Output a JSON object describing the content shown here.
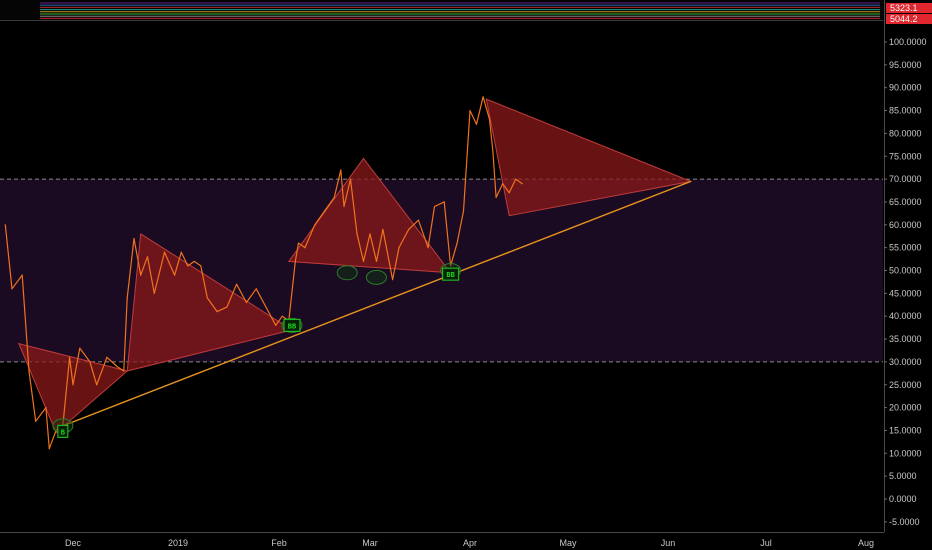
{
  "chart_data": {
    "type": "line",
    "title": "",
    "xlabel": "",
    "ylabel": "",
    "ylim": [
      -5,
      105
    ],
    "y_ticks": [
      "100.0000",
      "95.0000",
      "90.0000",
      "85.0000",
      "80.0000",
      "75.0000",
      "70.0000",
      "65.0000",
      "60.0000",
      "55.0000",
      "50.0000",
      "45.0000",
      "40.0000",
      "35.0000",
      "30.0000",
      "25.0000",
      "20.0000",
      "15.0000",
      "10.0000",
      "5.0000",
      "0.0000",
      "-5.0000"
    ],
    "y_tick_values": [
      100,
      95,
      90,
      85,
      80,
      75,
      70,
      65,
      60,
      55,
      50,
      45,
      40,
      35,
      30,
      25,
      20,
      15,
      10,
      5,
      0,
      -5
    ],
    "x_ticks": [
      "Dec",
      "2019",
      "Feb",
      "Mar",
      "Apr",
      "May",
      "Jun",
      "Jul",
      "Aug"
    ],
    "x_tick_dates": [
      "2018-12-01",
      "2019-01-01",
      "2019-02-01",
      "2019-03-01",
      "2019-04-01",
      "2019-05-01",
      "2019-06-01",
      "2019-07-01",
      "2019-08-01"
    ],
    "x_range": [
      "2018-11-11",
      "2019-08-10"
    ],
    "horizontal_levels": [
      70,
      30
    ],
    "zone": {
      "from": 30,
      "to": 70,
      "color": "#1a0a22"
    },
    "price_badges": [
      "5323.1",
      "5044.2"
    ],
    "series": [
      {
        "color": "#f0731c",
        "points": [
          [
            "2018-11-11",
            60
          ],
          [
            "2018-11-13",
            46
          ],
          [
            "2018-11-16",
            49
          ],
          [
            "2018-11-18",
            28
          ],
          [
            "2018-11-20",
            17
          ],
          [
            "2018-11-23",
            20
          ],
          [
            "2018-11-24",
            11
          ],
          [
            "2018-11-26",
            15
          ],
          [
            "2018-11-28",
            16
          ],
          [
            "2018-11-30",
            31
          ],
          [
            "2018-12-01",
            25
          ],
          [
            "2018-12-03",
            33
          ],
          [
            "2018-12-06",
            30
          ],
          [
            "2018-12-08",
            25
          ],
          [
            "2018-12-11",
            31
          ],
          [
            "2018-12-14",
            29
          ],
          [
            "2018-12-16",
            28
          ],
          [
            "2018-12-17",
            44
          ],
          [
            "2018-12-19",
            57
          ],
          [
            "2018-12-21",
            49
          ],
          [
            "2018-12-23",
            53
          ],
          [
            "2018-12-25",
            45
          ],
          [
            "2018-12-28",
            54
          ],
          [
            "2018-12-31",
            49
          ],
          [
            "2019-01-02",
            54
          ],
          [
            "2019-01-04",
            51
          ],
          [
            "2019-01-06",
            52
          ],
          [
            "2019-01-08",
            51
          ],
          [
            "2019-01-10",
            44
          ],
          [
            "2019-01-13",
            41
          ],
          [
            "2019-01-16",
            42
          ],
          [
            "2019-01-19",
            47
          ],
          [
            "2019-01-22",
            43
          ],
          [
            "2019-01-25",
            46
          ],
          [
            "2019-01-28",
            42
          ],
          [
            "2019-01-31",
            38
          ],
          [
            "2019-02-02",
            40
          ],
          [
            "2019-02-04",
            39
          ],
          [
            "2019-02-06",
            52
          ],
          [
            "2019-02-07",
            56
          ],
          [
            "2019-02-09",
            55
          ],
          [
            "2019-02-12",
            60
          ],
          [
            "2019-02-15",
            63
          ],
          [
            "2019-02-18",
            66
          ],
          [
            "2019-02-20",
            72
          ],
          [
            "2019-02-21",
            64
          ],
          [
            "2019-02-23",
            70
          ],
          [
            "2019-02-25",
            58
          ],
          [
            "2019-02-27",
            52
          ],
          [
            "2019-03-01",
            58
          ],
          [
            "2019-03-03",
            52
          ],
          [
            "2019-03-05",
            59
          ],
          [
            "2019-03-08",
            48
          ],
          [
            "2019-03-10",
            55
          ],
          [
            "2019-03-13",
            59
          ],
          [
            "2019-03-16",
            61
          ],
          [
            "2019-03-19",
            55
          ],
          [
            "2019-03-21",
            64
          ],
          [
            "2019-03-24",
            65
          ],
          [
            "2019-03-26",
            51
          ],
          [
            "2019-03-28",
            56
          ],
          [
            "2019-03-30",
            63
          ],
          [
            "2019-04-01",
            85
          ],
          [
            "2019-04-03",
            82
          ],
          [
            "2019-04-05",
            88
          ],
          [
            "2019-04-07",
            83
          ],
          [
            "2019-04-08",
            76
          ],
          [
            "2019-04-09",
            66
          ],
          [
            "2019-04-11",
            69
          ],
          [
            "2019-04-13",
            67
          ],
          [
            "2019-04-15",
            70
          ],
          [
            "2019-04-17",
            69
          ]
        ]
      }
    ],
    "trendline": {
      "from": [
        "2018-11-28",
        16
      ],
      "to": [
        "2019-06-08",
        69.5
      ],
      "color": "#e8951c"
    },
    "triangles": [
      [
        [
          "2018-11-15",
          34
        ],
        [
          "2018-11-26",
          14.5
        ],
        [
          "2018-12-17",
          28
        ]
      ],
      [
        [
          "2018-12-17",
          28
        ],
        [
          "2018-12-21",
          58
        ],
        [
          "2019-02-05",
          37
        ]
      ],
      [
        [
          "2019-02-04",
          52
        ],
        [
          "2019-02-27",
          74.5
        ],
        [
          "2019-03-26",
          49.5
        ]
      ],
      [
        [
          "2019-04-06",
          87.5
        ],
        [
          "2019-04-13",
          62
        ],
        [
          "2019-06-08",
          69.5
        ]
      ]
    ],
    "circle_markers": [
      {
        "date": "2018-11-28",
        "value": 16
      },
      {
        "date": "2019-02-05",
        "value": 38
      },
      {
        "date": "2019-02-22",
        "value": 49.5
      },
      {
        "date": "2019-03-03",
        "value": 48.5
      },
      {
        "date": "2019-03-26",
        "value": 50
      }
    ],
    "square_markers": [
      {
        "date": "2018-11-28",
        "value": 14.8,
        "label": "B"
      },
      {
        "date": "2019-02-05",
        "value": 38,
        "label": "BB"
      },
      {
        "date": "2019-03-26",
        "value": 49.2,
        "label": "BB"
      }
    ],
    "colors": {
      "background": "#000000",
      "line": "#f0731c",
      "triangle_fill": "#8b1a1a",
      "triangle_stroke": "#c23b3b",
      "trendline": "#e8951c",
      "dashed": "#8a8a8a",
      "marker": "#1fd11f",
      "badge": "#e0262f"
    }
  }
}
